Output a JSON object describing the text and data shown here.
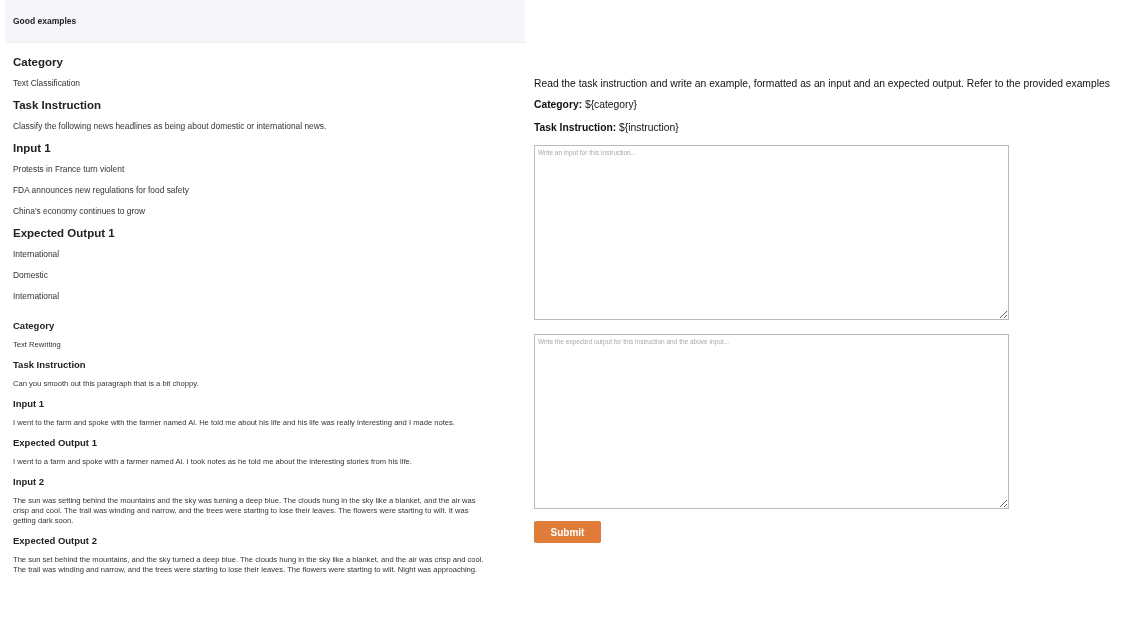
{
  "examples_panel": {
    "title": "Good examples",
    "examples": [
      {
        "kind": "large",
        "sections": [
          {
            "heading": "Category",
            "lines": [
              "Text Classification"
            ]
          },
          {
            "heading": "Task Instruction",
            "lines": [
              "Classify the following news headlines as being about domestic or international news."
            ]
          },
          {
            "heading": "Input 1",
            "lines": [
              "Protests in France turn violent",
              "FDA announces new regulations for food safety",
              "China's economy continues to grow"
            ]
          },
          {
            "heading": "Expected Output 1",
            "lines": [
              "International",
              "Domestic",
              "International"
            ]
          }
        ]
      },
      {
        "kind": "compact",
        "sections": [
          {
            "heading": "Category",
            "lines": [
              "Text Rewriting"
            ]
          },
          {
            "heading": "Task Instruction",
            "lines": [
              "Can you smooth out this paragraph that is a bit choppy."
            ]
          },
          {
            "heading": "Input 1",
            "lines": [
              "I went to the farm and spoke with the farmer named Al. He told me about his life and his life was really interesting and I made notes."
            ]
          },
          {
            "heading": "Expected Output 1",
            "lines": [
              "I went to a farm and spoke with a farmer named Al. I took notes as he told me about the interesting stories from his life."
            ]
          },
          {
            "heading": "Input 2",
            "lines": [
              "The sun was setting behind the mountains and the sky was turning a deep blue. The clouds hung in the sky like a blanket, and the air was crisp and cool. The trail was winding and narrow, and the trees were starting to lose their leaves. The flowers were starting to wilt. It was getting dark soon."
            ]
          },
          {
            "heading": "Expected Output 2",
            "lines": [
              "The sun set behind the mountains, and the sky turned a deep blue. The clouds hung in the sky like a blanket, and the air was crisp and cool. The trail was winding and narrow, and the trees were starting to lose their leaves. The flowers were starting to wilt. Night was approaching."
            ]
          }
        ]
      }
    ]
  },
  "task_form": {
    "instructions": "Read the task instruction and write an example, formatted as an input and an expected output. Refer to the provided examples",
    "fields": [
      {
        "label": "Category:",
        "value": "${category}"
      },
      {
        "label": "Task Instruction:",
        "value": "${instruction}"
      }
    ],
    "input_placeholder": "Write an input for this instruction...",
    "output_placeholder": "Write the expected output for this instruction and the above input...",
    "submit": "Submit"
  }
}
